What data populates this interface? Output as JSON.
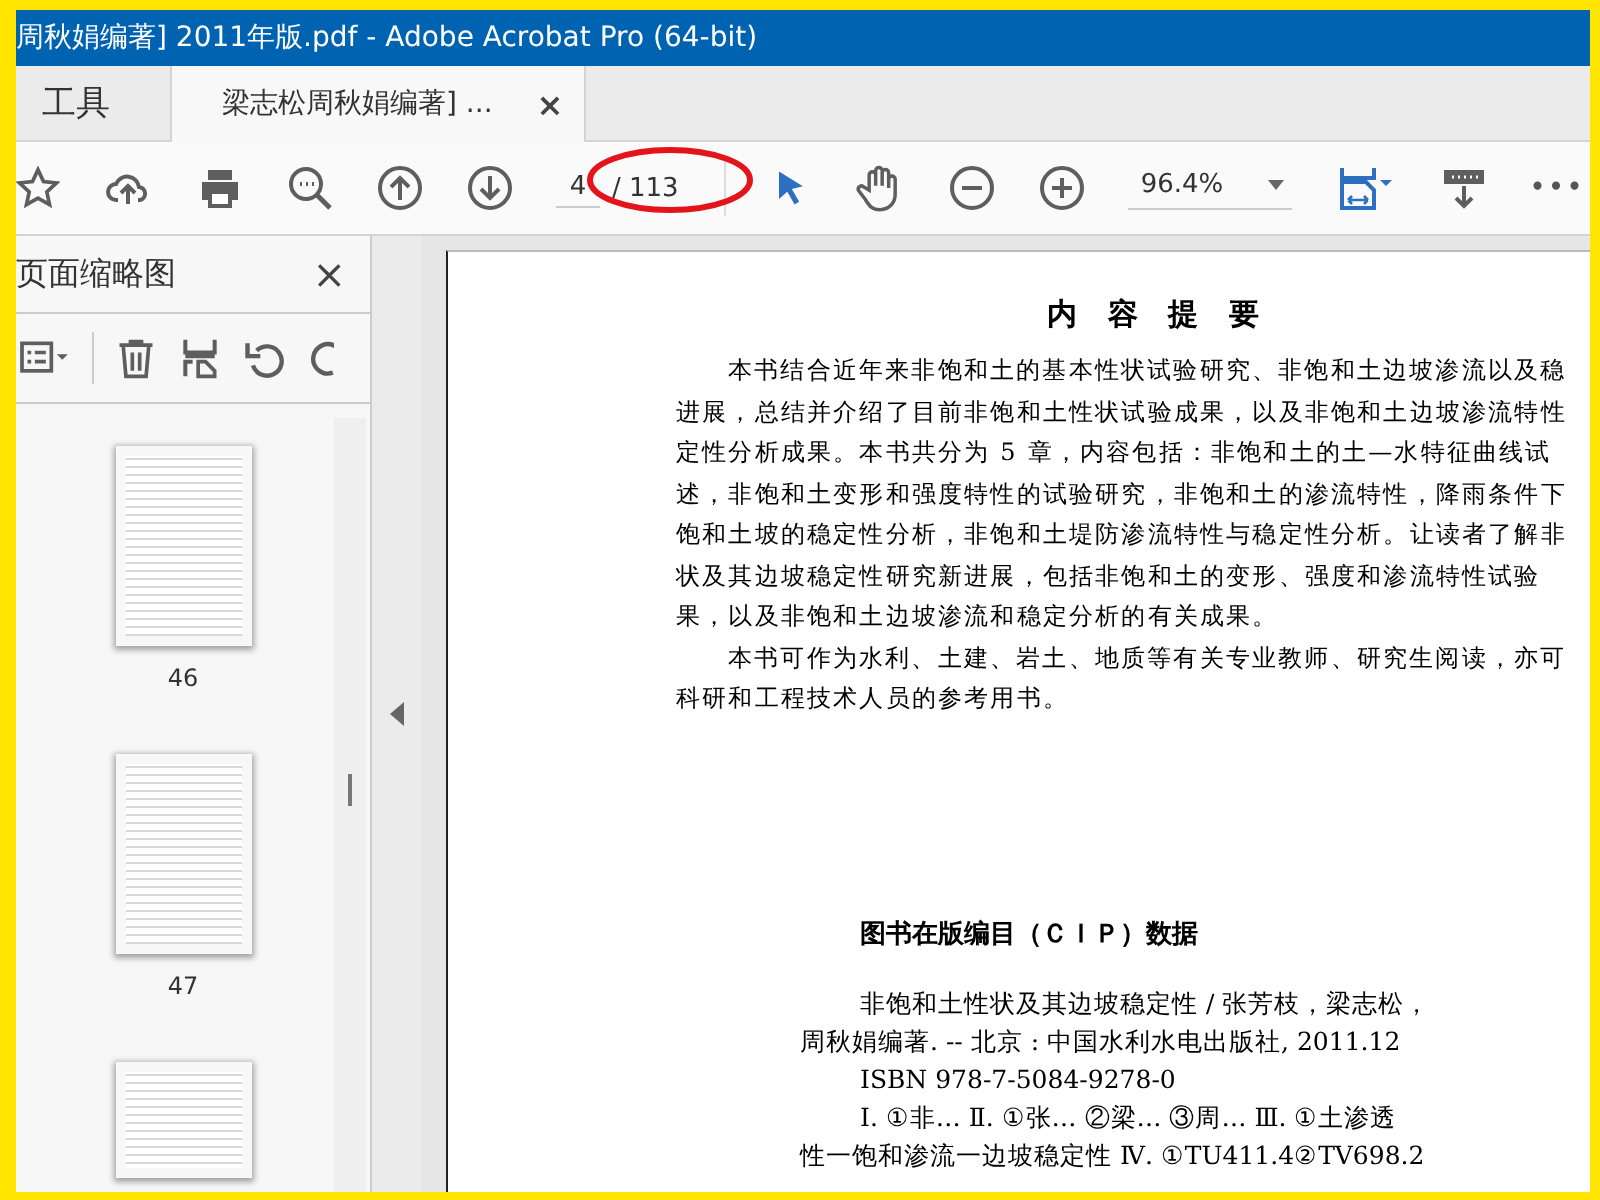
{
  "window": {
    "title": "周秋娟编著] 2011年版.pdf - Adobe Acrobat Pro (64-bit)"
  },
  "tabs": [
    {
      "label": "工具",
      "selected": false
    },
    {
      "label": "梁志松周秋娟编著] ...",
      "selected": true,
      "close": "×"
    }
  ],
  "toolbar": {
    "page_field": {
      "value": "4"
    },
    "page_total": "/ 113",
    "zoom_field": {
      "value": "96.4%"
    },
    "more": "•••"
  },
  "annotation": {
    "kind": "ellipse"
  },
  "thumbnail_panel": {
    "title": "页面缩略图",
    "close": "×",
    "thumbnails": [
      {
        "label": "46",
        "partial": false
      },
      {
        "label": "47",
        "partial": false
      },
      {
        "partial": true
      }
    ]
  },
  "document": {
    "heading": "内 容 提 要",
    "paragraph_lines": [
      {
        "text": "本书结合近年来非饱和土的基本性状试验研究、非饱和土边坡渗流以及稳",
        "indent": true
      },
      {
        "text": "进展，总结并介绍了目前非饱和土性状试验成果，以及非饱和土边坡渗流特性",
        "indent": false
      },
      {
        "text": "定性分析成果。本书共分为 5 章，内容包括：非饱和土的土—水特征曲线试",
        "indent": false
      },
      {
        "text": "述，非饱和土变形和强度特性的试验研究，非饱和土的渗流特性，降雨条件下",
        "indent": false
      },
      {
        "text": "饱和土坡的稳定性分析，非饱和土堤防渗流特性与稳定性分析。让读者了解非",
        "indent": false
      },
      {
        "text": "状及其边坡稳定性研究新进展，包括非饱和土的变形、强度和渗流特性试验",
        "indent": false
      },
      {
        "text": "果，以及非饱和土边坡渗流和稳定分析的有关成果。",
        "indent": false
      },
      {
        "text": "本书可作为水利、土建、岩土、地质等有关专业教师、研究生阅读，亦可",
        "indent": true
      },
      {
        "text": "科研和工程技术人员的参考用书。",
        "indent": false
      }
    ],
    "cip_title": "图书在版编目（ＣＩＰ）数据",
    "cip_lines": [
      {
        "text": "非饱和土性状及其边坡稳定性 / 张芳枝，梁志松，",
        "indent": true
      },
      {
        "text": "周秋娟编著. -- 北京 : 中国水利水电出版社, 2011.12",
        "indent": false
      },
      {
        "text": "ISBN 978-7-5084-9278-0",
        "indent": true
      },
      {
        "text": "Ⅰ. ①非… Ⅱ. ①张… ②梁… ③周… Ⅲ. ①土渗透",
        "indent": true
      },
      {
        "text": "性一饱和渗流一边坡稳定性 Ⅳ. ①TU411.4②TV698.2",
        "indent": false
      }
    ]
  }
}
